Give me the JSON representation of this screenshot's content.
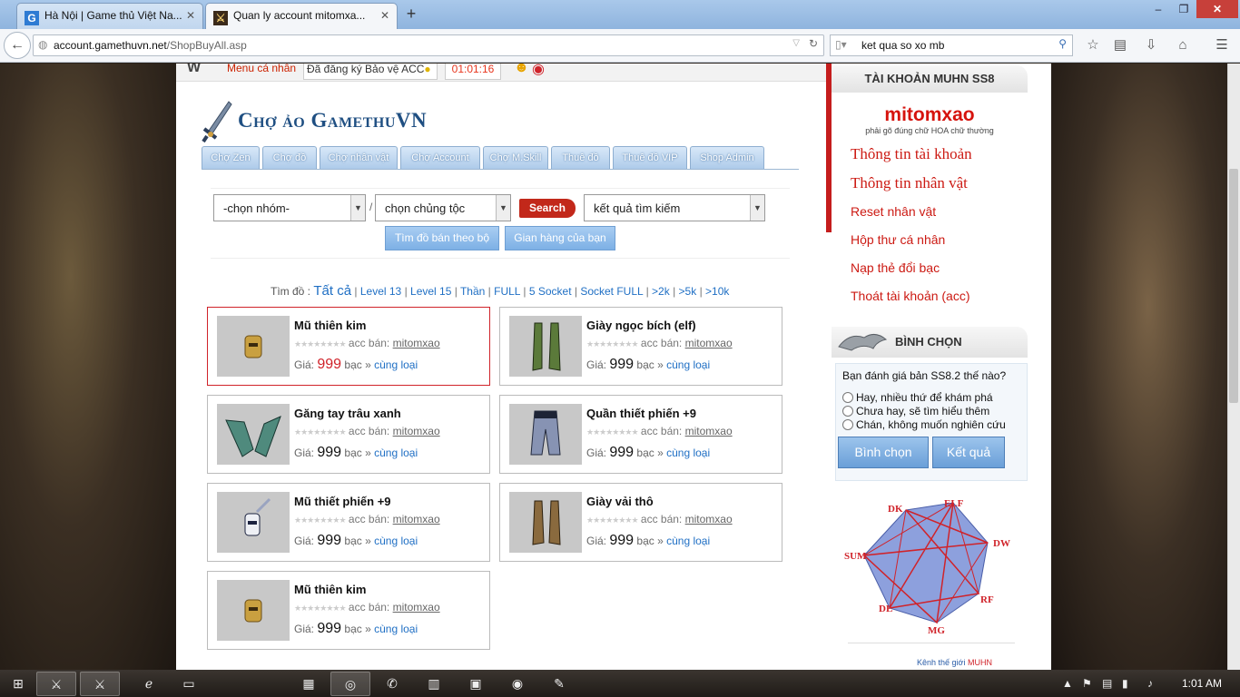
{
  "browser": {
    "tabs": [
      {
        "title": "Hà Nội | Game thủ Việt Na...",
        "favicon": "G"
      },
      {
        "title": "Quan ly account mitomxa...",
        "favicon": "⚔"
      }
    ],
    "new_tab": "+",
    "url_domain": "account.gamethuvn.net",
    "url_path": "/ShopBuyAll.asp",
    "search_query": "ket qua so xo mb"
  },
  "top_strip": {
    "menu": "Menu cá nhân",
    "registered": "Đã đăng ký Bảo vệ ACC",
    "timer": "01:01:16"
  },
  "site": {
    "title": "Chợ ảo GamethuVN",
    "menu_tabs": [
      "Chợ Zen",
      "Chợ đồ",
      "Chợ nhân vật",
      "Chợ Account",
      "Chợ M.Skill",
      "Thuê đồ",
      "Thuê đồ VIP",
      "Shop Admin"
    ]
  },
  "search": {
    "group_select": "-chọn nhóm-",
    "race_select": "chọn chủng tộc",
    "slash": "/",
    "search_button": "Search",
    "results_select": "kết quả tìm kiếm",
    "btn_find_set": "Tìm đồ bán theo bộ",
    "btn_my_shop": "Gian hàng của bạn"
  },
  "filter": {
    "label": "Tìm đồ :",
    "all": "Tất cả",
    "links": [
      "Level 13",
      "Level 15",
      "Thần",
      "FULL",
      "5 Socket",
      "Socket FULL",
      ">2k",
      ">5k",
      ">10k"
    ]
  },
  "items": [
    {
      "name": "Mũ thiên kim",
      "seller_label": "acc bán:",
      "seller": "mitomxao",
      "price_label": "Giá:",
      "price": "999",
      "currency": "bạc",
      "similar": "cùng loại",
      "icon": "helm-icon"
    },
    {
      "name": "Giày ngọc bích (elf)",
      "seller_label": "acc bán:",
      "seller": "mitomxao",
      "price_label": "Giá:",
      "price": "999",
      "currency": "bạc",
      "similar": "cùng loại",
      "icon": "boots-icon"
    },
    {
      "name": "Găng tay trâu xanh",
      "seller_label": "acc bán:",
      "seller": "mitomxao",
      "price_label": "Giá:",
      "price": "999",
      "currency": "bạc",
      "similar": "cùng loại",
      "icon": "gloves-icon"
    },
    {
      "name": "Quần thiết phiến +9",
      "seller_label": "acc bán:",
      "seller": "mitomxao",
      "price_label": "Giá:",
      "price": "999",
      "currency": "bạc",
      "similar": "cùng loại",
      "icon": "pants-icon"
    },
    {
      "name": "Mũ thiết phiến +9",
      "seller_label": "acc bán:",
      "seller": "mitomxao",
      "price_label": "Giá:",
      "price": "999",
      "currency": "bạc",
      "similar": "cùng loại",
      "icon": "helm-icon"
    },
    {
      "name": "Giày vải thô",
      "seller_label": "acc bán:",
      "seller": "mitomxao",
      "price_label": "Giá:",
      "price": "999",
      "currency": "bạc",
      "similar": "cùng loại",
      "icon": "boots-icon"
    },
    {
      "name": "Mũ thiên kim",
      "seller_label": "acc bán:",
      "seller": "mitomxao",
      "price_label": "Giá:",
      "price": "999",
      "currency": "bạc",
      "similar": "cùng loại",
      "icon": "helm-icon"
    }
  ],
  "sidebar": {
    "account_heading": "TÀI KHOẢN MUHN SS8",
    "username": "mitomxao",
    "hint": "phải gõ đúng chữ HOA chữ thường",
    "links": [
      "Thông tin tài khoản",
      "Thông tin nhân vật",
      "Reset nhân vật",
      "Hộp thư cá nhân",
      "Nạp thẻ đổi bạc",
      "Thoát tài khoản (acc)"
    ],
    "poll_heading": "BÌNH CHỌN",
    "poll_question": "Bạn đánh giá bản SS8.2 thế nào?",
    "poll_options": [
      "Hay, nhiều thứ để khám phá",
      "Chưa hay, sẽ tìm hiểu thêm",
      "Chán, không muốn nghiên cứu"
    ],
    "vote_button": "Bình chọn",
    "result_button": "Kết quả",
    "class_labels": [
      "DK",
      "ELF",
      "DW",
      "RF",
      "MG",
      "DL",
      "SUM"
    ],
    "banner_text": "Kênh thế giới",
    "banner_highlight": "MUHN"
  },
  "taskbar": {
    "clock": "1:01 AM"
  },
  "colors": {
    "accent_blue": "#1f4f82",
    "link_blue": "#1f6fc4",
    "red": "#d0232a"
  }
}
